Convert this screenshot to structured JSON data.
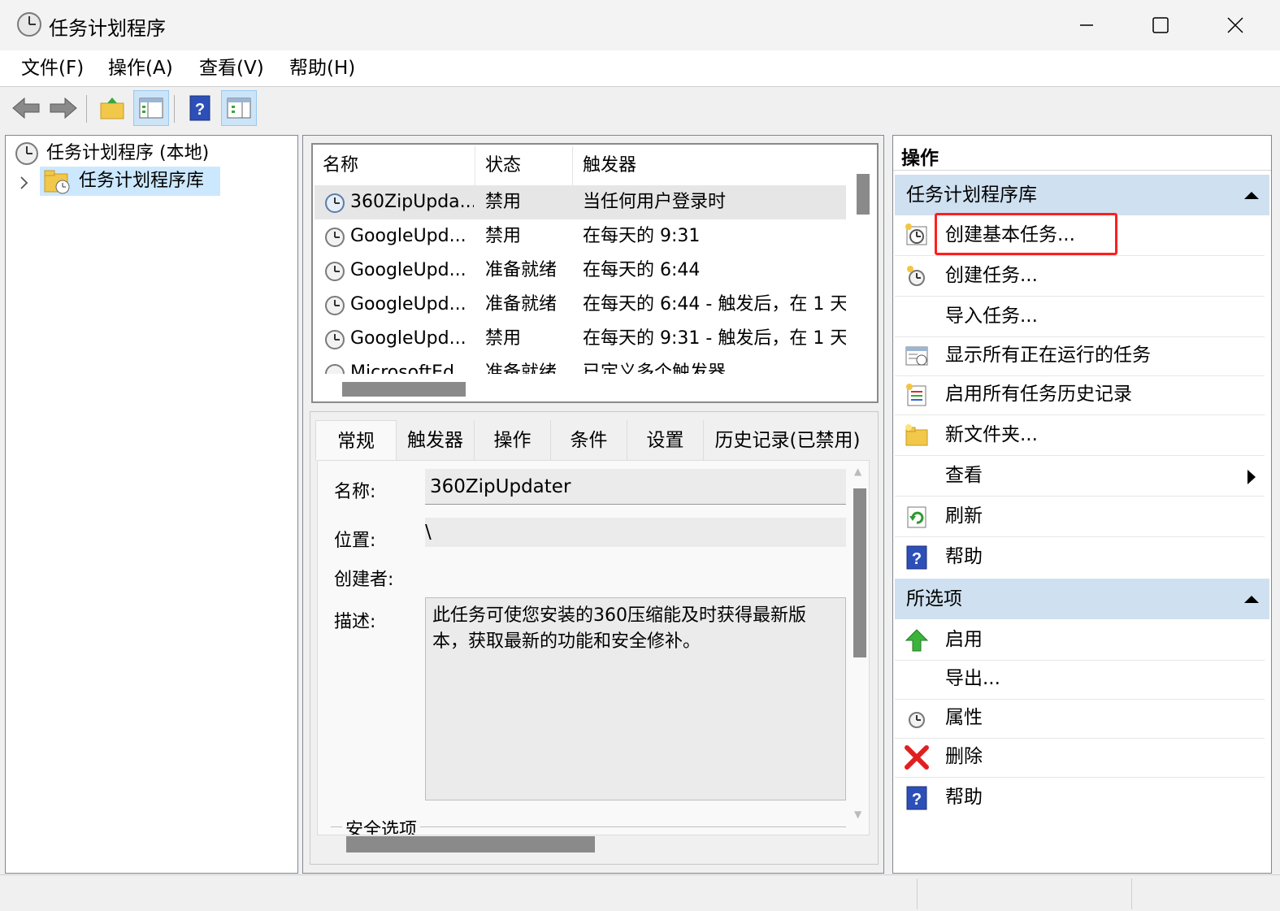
{
  "window": {
    "title": "任务计划程序"
  },
  "menu": [
    "文件(F)",
    "操作(A)",
    "查看(V)",
    "帮助(H)"
  ],
  "tree": {
    "root": "任务计划程序 (本地)",
    "library": "任务计划程序库"
  },
  "list": {
    "columns": [
      "名称",
      "状态",
      "触发器"
    ],
    "rows": [
      {
        "name": "360ZipUpda...",
        "status": "禁用",
        "trigger": "当任何用户登录时"
      },
      {
        "name": "GoogleUpd...",
        "status": "禁用",
        "trigger": "在每天的 9:31"
      },
      {
        "name": "GoogleUpd...",
        "status": "准备就绪",
        "trigger": "在每天的 6:44"
      },
      {
        "name": "GoogleUpd...",
        "status": "准备就绪",
        "trigger": "在每天的 6:44 - 触发后，在 1 天"
      },
      {
        "name": "GoogleUpd...",
        "status": "禁用",
        "trigger": "在每天的 9:31 - 触发后，在 1 天"
      },
      {
        "name": "MicrosoftEd...",
        "status": "准备就绪",
        "trigger": "已定义多个触发器"
      }
    ]
  },
  "detail": {
    "tabs": [
      "常规",
      "触发器",
      "操作",
      "条件",
      "设置",
      "历史记录(已禁用)"
    ],
    "name_label": "名称:",
    "name_value": "360ZipUpdater",
    "location_label": "位置:",
    "location_value": "\\",
    "author_label": "创建者:",
    "desc_label": "描述:",
    "desc_value": "此任务可使您安装的360压缩能及时获得最新版本，获取最新的功能和安全修补。",
    "security_label": "安全选项"
  },
  "actions": {
    "header": "操作",
    "section1": {
      "title": "任务计划程序库",
      "items": [
        "创建基本任务...",
        "创建任务...",
        "导入任务...",
        "显示所有正在运行的任务",
        "启用所有任务历史记录",
        "新文件夹...",
        "查看",
        "刷新",
        "帮助"
      ]
    },
    "section2": {
      "title": "所选项",
      "items": [
        "启用",
        "导出...",
        "属性",
        "删除",
        "帮助"
      ]
    }
  },
  "colors": {
    "highlight_box": "#ff1e1e",
    "section_header": "#cfe0f0",
    "selected": "#cce8ff"
  }
}
